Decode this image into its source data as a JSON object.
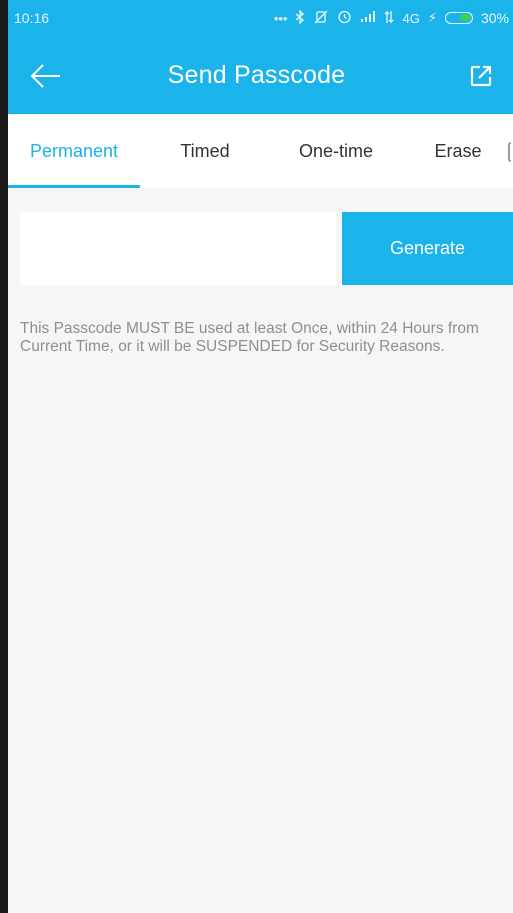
{
  "status_bar": {
    "time": "10:16",
    "icons": [
      "more-dots-icon",
      "bluetooth-icon",
      "vibrate-off-icon",
      "alarm-icon",
      "signal-icon",
      "data-arrows-icon"
    ],
    "network": "4G",
    "charging": "⚡",
    "battery_percent": "30%",
    "battery_level": 0.3,
    "battery_color": "#3bd25a"
  },
  "header": {
    "title": "Send Passcode",
    "back_icon": "back-arrow-icon",
    "share_icon": "share-icon",
    "color": "#1ab3ea"
  },
  "tabs": [
    {
      "label": "Permanent",
      "active": true
    },
    {
      "label": "Timed",
      "active": false
    },
    {
      "label": "One-time",
      "active": false
    },
    {
      "label": "Erase",
      "active": false
    }
  ],
  "generator": {
    "passcode_value": "",
    "button_label": "Generate"
  },
  "notice": "This Passcode MUST BE used at least Once, within 24 Hours from Current Time, or it will be SUSPENDED for Security Reasons."
}
